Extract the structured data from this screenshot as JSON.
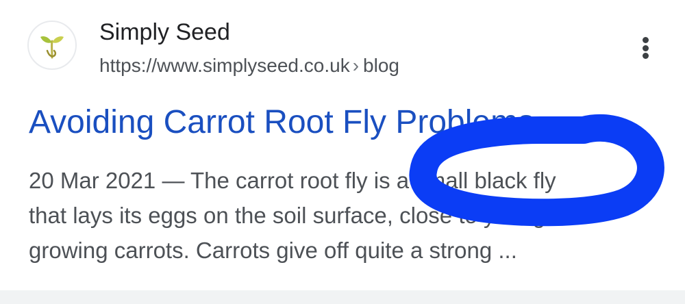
{
  "result": {
    "site_name": "Simply Seed",
    "url": "https://www.simplyseed.co.uk",
    "url_separator": "›",
    "url_path": "blog",
    "favicon": "seedling-icon",
    "menu_icon": "more-vert-icon",
    "title": "Avoiding Carrot Root Fly Problems",
    "snippet_lines": [
      "20 Mar 2021 — The carrot root fly is a small black fly",
      "that lays its eggs on the soil surface, close to young",
      "growing carrots. Carrots give off quite a strong ..."
    ]
  },
  "annotation": {
    "shape": "hand-drawn-ellipse",
    "circled_text": "small black fly",
    "color": "#0b3df5"
  },
  "colors": {
    "title_link": "#1a4fc0",
    "snippet_text": "#4d5156",
    "site_name": "#202124",
    "background": "#ffffff",
    "bottom_strip": "#f1f3f4"
  }
}
